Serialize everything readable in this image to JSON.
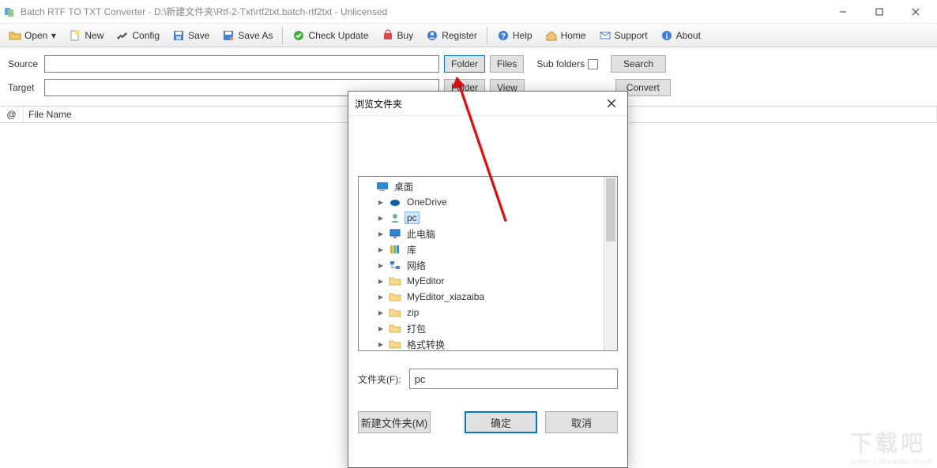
{
  "title": "Batch RTF TO TXT Converter - D:\\新建文件夹\\Rtf-2-Txt\\rtf2txt.batch-rtf2txt - Unlicensed",
  "toolbar": {
    "open": "Open",
    "new": "New",
    "config": "Config",
    "save": "Save",
    "saveas": "Save As",
    "check": "Check Update",
    "buy": "Buy",
    "register": "Register",
    "help": "Help",
    "home": "Home",
    "support": "Support",
    "about": "About"
  },
  "labels": {
    "source": "Source",
    "target": "Target",
    "folder": "Folder",
    "files": "Files",
    "subfolders": "Sub folders",
    "search": "Search",
    "view": "View",
    "convert": "Convert"
  },
  "list": {
    "col1": "@",
    "col2": "File Name"
  },
  "dialog": {
    "title": "浏览文件夹",
    "folder_label": "文件夹(F):",
    "folder_value": "pc",
    "new_folder": "新建文件夹(M)",
    "ok": "确定",
    "cancel": "取消",
    "tree": {
      "desktop": "桌面",
      "onedrive": "OneDrive",
      "pc": "pc",
      "thispc": "此电脑",
      "libs": "库",
      "network": "网络",
      "f_myeditor": "MyEditor",
      "f_myeditor_x": "MyEditor_xiazaiba",
      "f_zip": "zip",
      "f_dabao": "打包",
      "f_geshi": "格式转换"
    }
  },
  "watermark": {
    "big": "下载吧",
    "sub": "www.xiazaiba.com"
  }
}
